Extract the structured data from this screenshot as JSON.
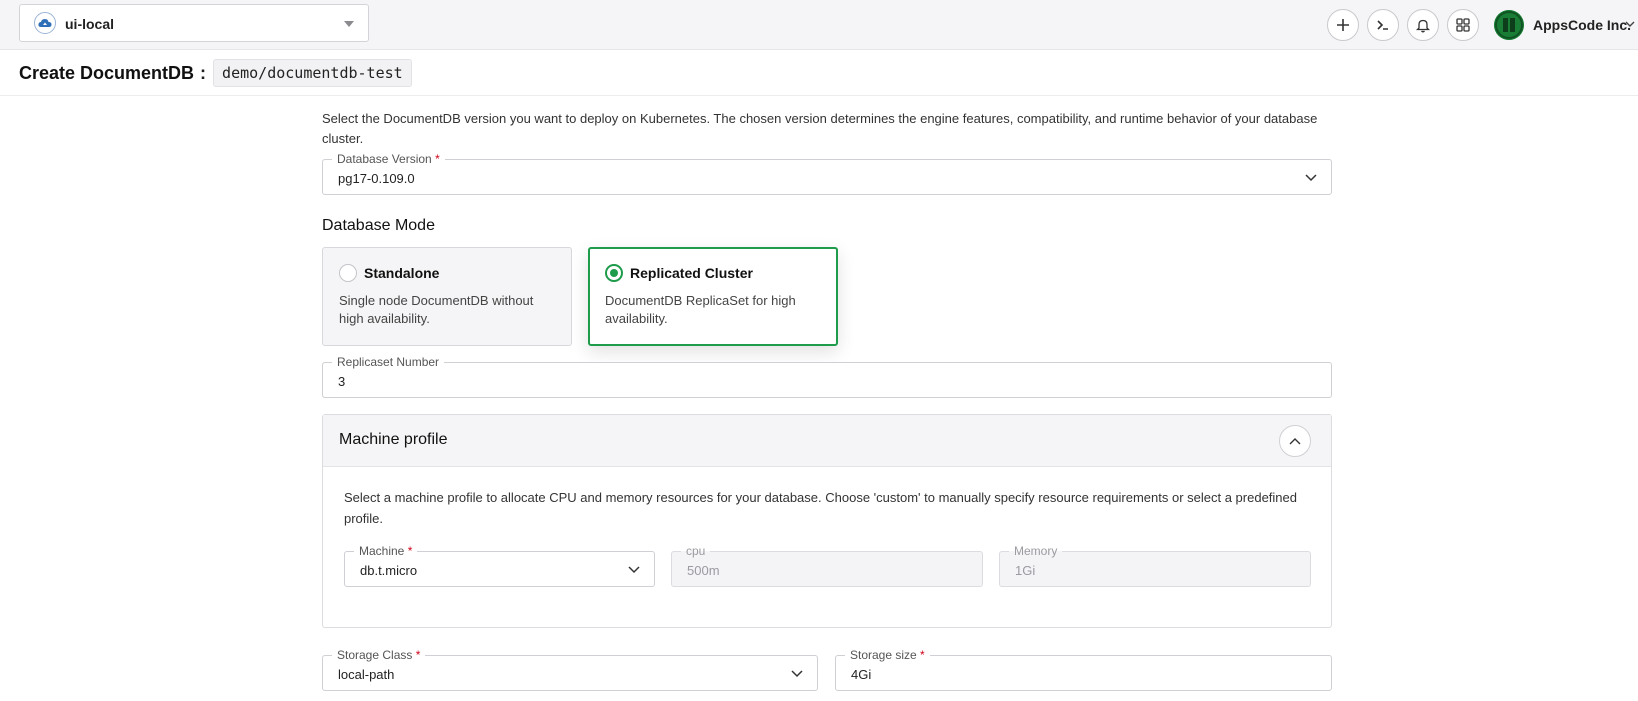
{
  "topbar": {
    "cluster_name": "ui-local",
    "org_name": "AppsCode Inc."
  },
  "header": {
    "title": "Create DocumentDB",
    "separator": ":",
    "resource": "demo/documentdb-test"
  },
  "form": {
    "version_description": "Select the DocumentDB version you want to deploy on Kubernetes. The chosen version determines the engine features, compatibility, and runtime behavior of your database cluster.",
    "database_version": {
      "label": "Database Version",
      "value": "pg17-0.109.0"
    },
    "database_mode": {
      "heading": "Database Mode",
      "options": [
        {
          "title": "Standalone",
          "description": "Single node DocumentDB without high availability.",
          "selected": false
        },
        {
          "title": "Replicated Cluster",
          "description": "DocumentDB ReplicaSet for high availability.",
          "selected": true
        }
      ]
    },
    "replicaset_number": {
      "label": "Replicaset Number",
      "value": "3"
    },
    "machine_profile": {
      "title": "Machine profile",
      "description": "Select a machine profile to allocate CPU and memory resources for your database. Choose 'custom' to manually specify resource requirements or select a predefined profile.",
      "machine": {
        "label": "Machine",
        "value": "db.t.micro"
      },
      "cpu": {
        "label": "cpu",
        "value": "500m"
      },
      "memory": {
        "label": "Memory",
        "value": "1Gi"
      }
    },
    "storage_class": {
      "label": "Storage Class",
      "value": "local-path"
    },
    "storage_size": {
      "label": "Storage size",
      "value": "4Gi"
    }
  },
  "colors": {
    "accent_green": "#1e9b4b",
    "required_red": "#d0021b"
  },
  "icons": [
    "cluster-cloud-icon",
    "plus-icon",
    "terminal-icon",
    "bell-icon",
    "apps-grid-icon",
    "chevron-down-icon",
    "chevron-up-icon"
  ]
}
